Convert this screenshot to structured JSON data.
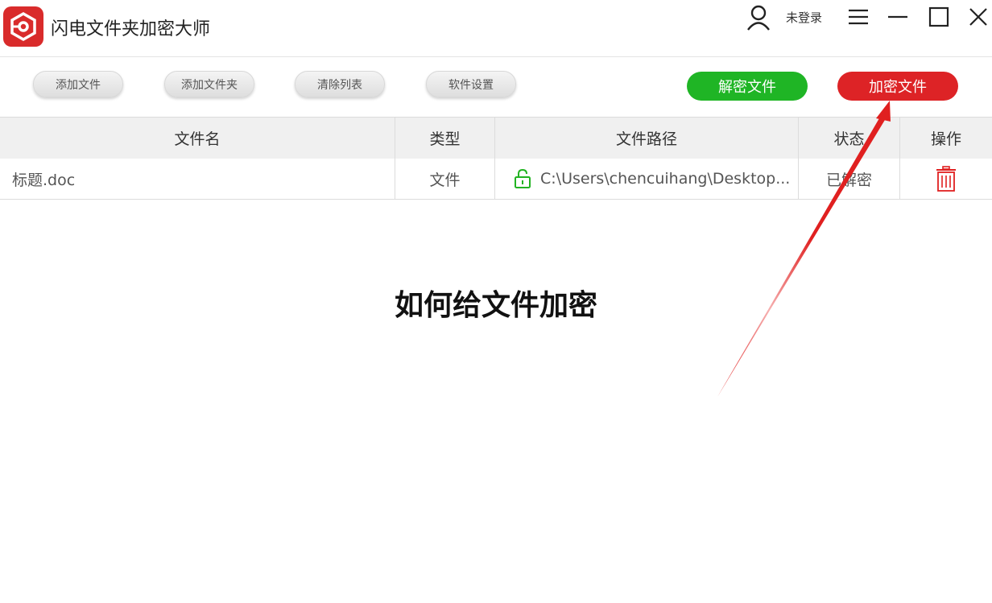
{
  "app": {
    "title": "闪电文件夹加密大师"
  },
  "header": {
    "login_status": "未登录",
    "icons": [
      "user-icon",
      "menu-icon",
      "minimize-icon",
      "maximize-icon",
      "close-icon"
    ]
  },
  "toolbar": {
    "add_file": "添加文件",
    "add_folder": "添加文件夹",
    "clear_list": "清除列表",
    "settings": "软件设置",
    "decrypt": "解密文件",
    "encrypt": "加密文件"
  },
  "table": {
    "columns": [
      "文件名",
      "类型",
      "文件路径",
      "状态",
      "操作"
    ],
    "rows": [
      {
        "name": "标题.doc",
        "type": "文件",
        "path": "C:\\Users\\chencuihang\\Desktop...",
        "status": "已解密"
      }
    ]
  },
  "overlay": {
    "title": "如何给文件加密"
  },
  "colors": {
    "decrypt": "#1fb525",
    "encrypt": "#dd2326",
    "lock": "#22b322",
    "arrow": "#e02020"
  }
}
